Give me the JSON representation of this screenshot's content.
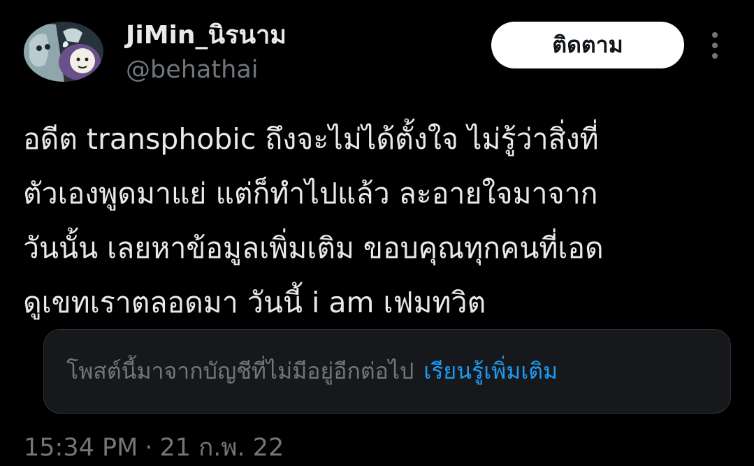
{
  "author": {
    "display_name": "JiMin_นิรนาม",
    "handle": "@behathai"
  },
  "follow_label": "ติดตาม",
  "tweet_lines": [
    "อดีต transphobic ถึงจะไม่ได้ตั้งใจ ไม่รู้ว่าสิ่งที่",
    "ตัวเองพูดมาแย่ แต่ก็ทำไปแล้ว ละอายใจมาจาก",
    "วันนั้น เลยหาข้อมูลเพิ่มเติม ขอบคุณทุกคนที่เอด",
    "ดูเขทเราตลอดมา วันนี้ i am เฟมทวิต"
  ],
  "notice": {
    "text": "โพสต์นี้มาจากบัญชีที่ไม่มีอยู่อีกต่อไป",
    "link": "เรียนรู้เพิ่มเติม"
  },
  "meta": {
    "time": "15:34 PM",
    "separator": "·",
    "date": "21 ก.พ. 22"
  },
  "icons": {
    "more": "more-vertical-icon"
  },
  "colors": {
    "background": "#000000",
    "text": "#e7e9ea",
    "secondary_text": "#71767b",
    "link": "#1d9bf0",
    "follow_button_bg": "#ffffff",
    "notice_bg": "#16181c"
  }
}
